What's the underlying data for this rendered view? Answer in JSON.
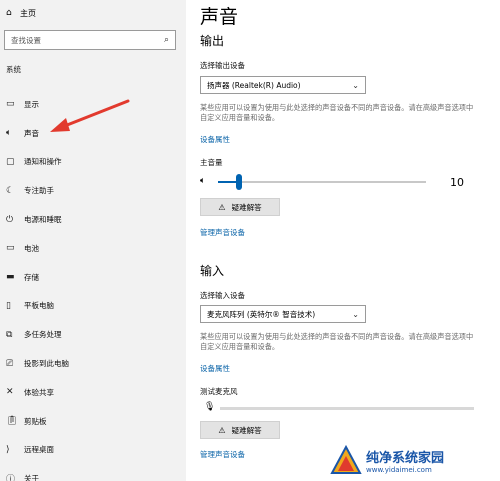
{
  "sidebar": {
    "home": {
      "icon": "home-icon",
      "label": "主页"
    },
    "search_placeholder": "查找设置",
    "section": "系统",
    "items": [
      {
        "icon": "display-icon",
        "label": "显示"
      },
      {
        "icon": "speaker-icon",
        "label": "声音"
      },
      {
        "icon": "notification-icon",
        "label": "通知和操作"
      },
      {
        "icon": "moon-icon",
        "label": "专注助手"
      },
      {
        "icon": "power-icon",
        "label": "电源和睡眠"
      },
      {
        "icon": "battery-icon",
        "label": "电池"
      },
      {
        "icon": "storage-icon",
        "label": "存储"
      },
      {
        "icon": "tablet-icon",
        "label": "平板电脑"
      },
      {
        "icon": "multitask-icon",
        "label": "多任务处理"
      },
      {
        "icon": "project-icon",
        "label": "投影到此电脑"
      },
      {
        "icon": "shared-experience-icon",
        "label": "体验共享"
      },
      {
        "icon": "clipboard-icon",
        "label": "剪贴板"
      },
      {
        "icon": "remote-desktop-icon",
        "label": "远程桌面"
      },
      {
        "icon": "info-icon",
        "label": "关于"
      }
    ]
  },
  "main": {
    "title": "声音",
    "output": {
      "heading": "输出",
      "device_label": "选择输出设备",
      "device_value": "扬声器 (Realtek(R) Audio)",
      "description": "某些应用可以设置为使用与此处选择的声音设备不同的声音设备。请在高级声音选项中自定义应用音量和设备。",
      "device_properties_link": "设备属性",
      "volume_label": "主音量",
      "volume_value": "10",
      "volume_fraction": 0.1,
      "troubleshoot_label": "疑难解答",
      "manage_link": "管理声音设备"
    },
    "input": {
      "heading": "输入",
      "device_label": "选择输入设备",
      "device_value": "麦克风阵列 (英特尔® 智音技术)",
      "description": "某些应用可以设置为使用与此处选择的声音设备不同的声音设备。请在高级声音选项中自定义应用音量和设备。",
      "device_properties_link": "设备属性",
      "test_label": "测试麦克风",
      "troubleshoot_label": "疑难解答",
      "manage_link": "管理声音设备"
    }
  },
  "watermark": {
    "name": "纯净系统家园",
    "url": "www.yidaimei.com"
  },
  "colors": {
    "accent": "#0063b1",
    "link": "#0b64a8",
    "arrow": "#e23a2e",
    "sidebar_bg": "#f2f2f2"
  }
}
